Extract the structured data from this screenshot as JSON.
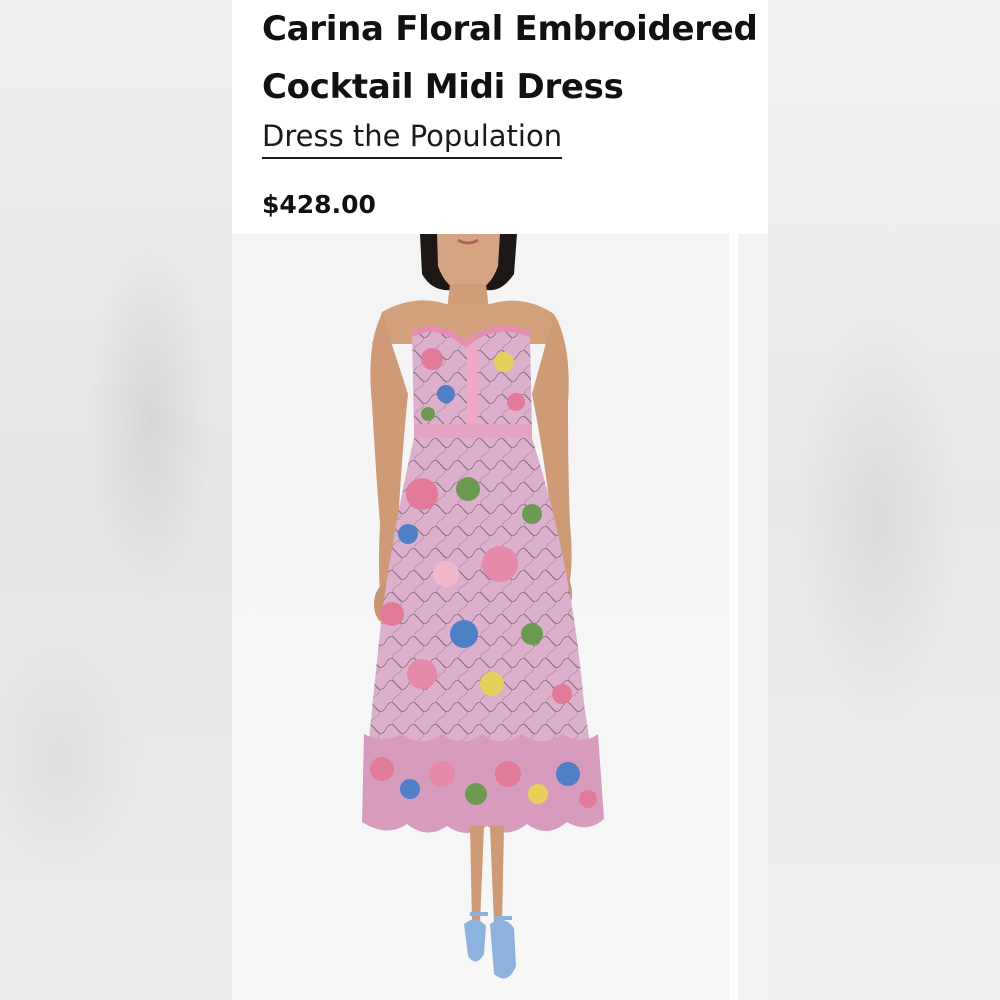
{
  "product": {
    "title_line1": "Carina Floral Embroidered",
    "title_line2": "Cocktail Midi Dress",
    "brand": "Dress the Population",
    "price": "$428.00"
  },
  "image": {
    "subject": "model-wearing-floral-strapless-midi-dress",
    "colors": {
      "dress_base": "#d9a9c9",
      "flower_pink": "#e27a9a",
      "flower_blue": "#4f7fc4",
      "leaf_green": "#6c9a52",
      "flower_yellow": "#e6cf5a",
      "skin": "#d2a07c",
      "hair": "#1d1816",
      "shoe": "#8eb2de"
    }
  }
}
